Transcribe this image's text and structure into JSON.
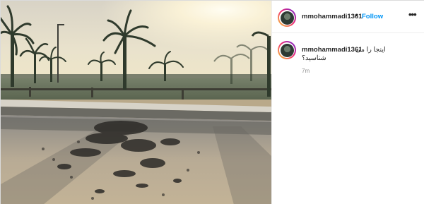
{
  "post": {
    "photo_alt": "",
    "header": {
      "username": "mmohammadi1361",
      "separator": "•",
      "follow_label": "Follow",
      "more_icon": "more-horizontal-icon",
      "more_glyph": "•••"
    },
    "caption": {
      "username": "mmohammadi1361",
      "line1": "اینجا را می",
      "line2": "شناسید؟",
      "time": "7m"
    }
  },
  "colors": {
    "follow_blue": "#0095f6",
    "muted": "#8e8e8e",
    "text": "#262626",
    "border": "#dbdbdb"
  }
}
